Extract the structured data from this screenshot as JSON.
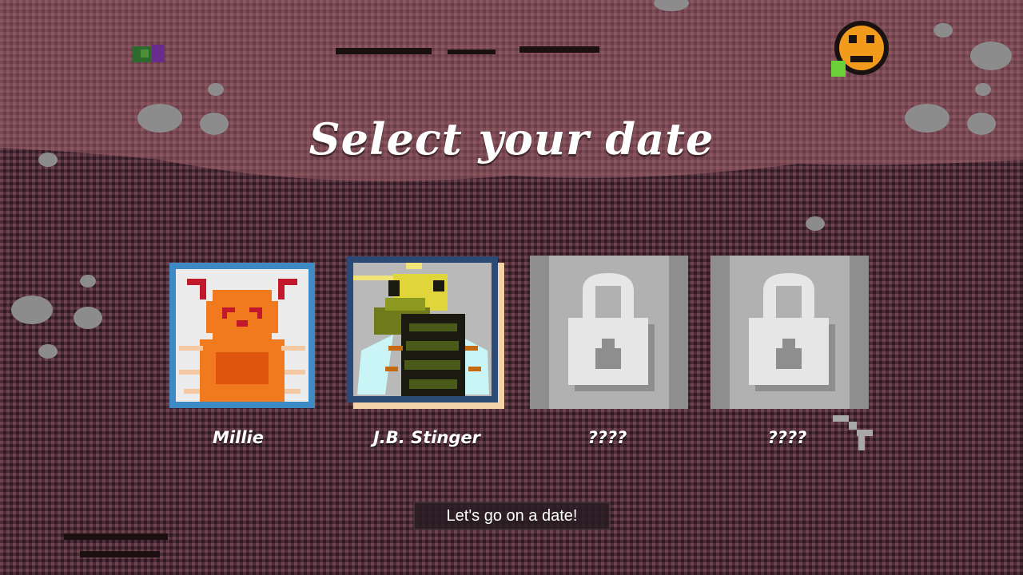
{
  "title": "Select your date",
  "characters": [
    {
      "name": "Millie",
      "locked": false,
      "icon": "ant-portrait"
    },
    {
      "name": "J.B. Stinger",
      "locked": false,
      "icon": "wasp-portrait"
    },
    {
      "name": "????",
      "locked": true,
      "icon": "lock-icon"
    },
    {
      "name": "????",
      "locked": true,
      "icon": "lock-icon"
    }
  ],
  "start_button_label": "Let's go on a date!",
  "colors": {
    "dirt_top": "#7a4a52",
    "dirt_bottom": "#4a2a35",
    "millie_frame": "#3d8ac4",
    "stinger_frame": "#2b4a75",
    "locked_tile": "#b1b1b1"
  }
}
